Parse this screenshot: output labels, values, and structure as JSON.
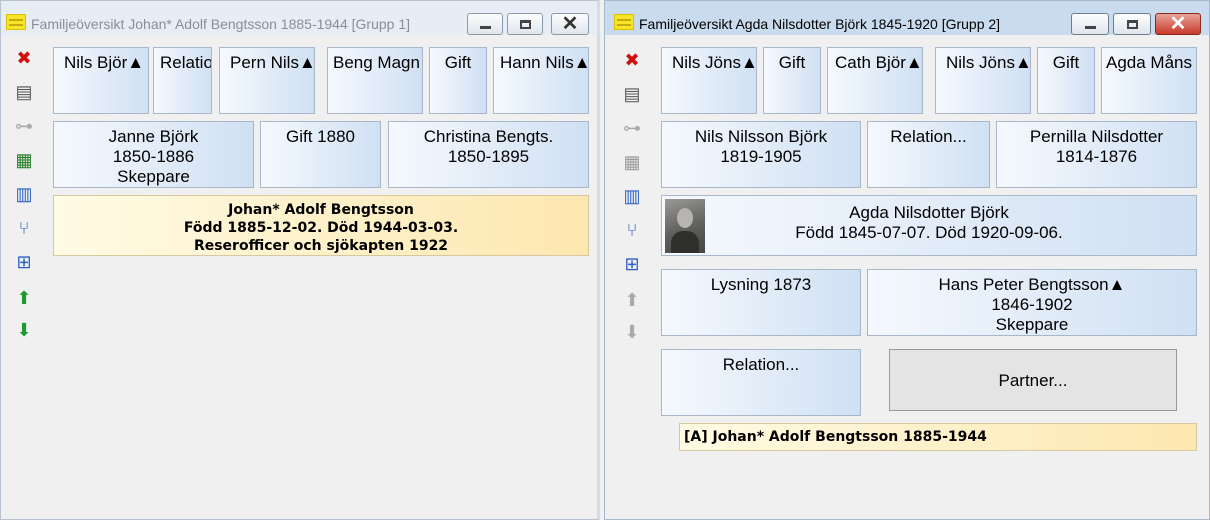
{
  "window1": {
    "title": "Familjeöversikt Johan* Adolf Bengtsson 1885-1944 [Grupp 1]",
    "grandparents": [
      "Nils Björ▲",
      "Relatio",
      "Pern Nils▲",
      "Beng Magn",
      "Gift",
      "Hann Nils▲"
    ],
    "father": {
      "name": "Janne Björk",
      "years": "1850-1886",
      "occupation": "Skeppare"
    },
    "marriage": "Gift 1880",
    "mother": {
      "name": "Christina Bengts.",
      "years": "1850-1895"
    },
    "person": {
      "name": "Johan* Adolf Bengtsson",
      "dates": "Född 1885-12-02. Död 1944-03-03.",
      "occupation": "Reserofficer och sjökapten 1922"
    }
  },
  "window2": {
    "title": "Familjeöversikt Agda Nilsdotter Björk 1845-1920 [Grupp 2]",
    "grandparents": [
      "Nils Jöns▲",
      "Gift",
      "Cath Björ▲",
      "Nils Jöns▲",
      "Gift",
      "Agda Måns"
    ],
    "father": {
      "name": "Nils Nilsson Björk",
      "years": "1819-1905"
    },
    "relation": "Relation...",
    "mother": {
      "name": "Pernilla Nilsdotter",
      "years": "1814-1876"
    },
    "person": {
      "name": "Agda Nilsdotter Björk",
      "dates": "Född 1845-07-07. Död 1920-09-06."
    },
    "event": "Lysning 1873",
    "partner": {
      "name": "Hans Peter Bengtsson▲",
      "years": "1846-1902",
      "occupation": "Skeppare"
    },
    "relation2": "Relation...",
    "partner_placeholder": "Partner...",
    "child": "[A] Johan* Adolf Bengtsson 1885-1944"
  },
  "icons": {
    "close_glyph": "✕",
    "max_glyph": "",
    "min_glyph": "",
    "tool_delete": "✖",
    "tool_notes": "▤",
    "tool_tree": "⊶",
    "tool_search": "▦",
    "tool_columns": "▥",
    "tool_branch": "⑂",
    "tool_org": "⊞",
    "tool_up": "⬆",
    "tool_down": "⬇"
  },
  "colors": {
    "accent_blue": "#2a5fc4",
    "tile_blue": "#d0e0f3",
    "highlight_yellow": "#fde7b0",
    "close_red": "#c73a2a"
  }
}
